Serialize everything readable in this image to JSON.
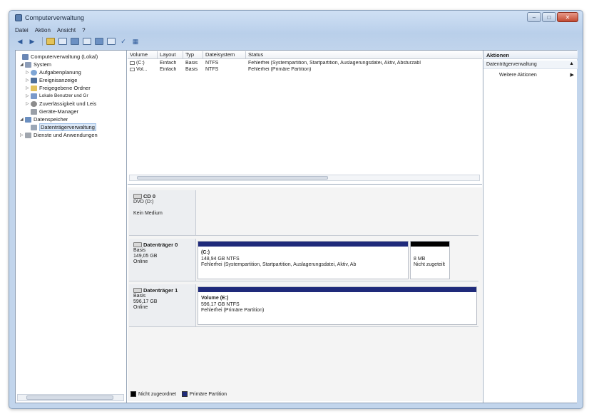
{
  "window": {
    "title": "Computerverwaltung"
  },
  "menu": [
    {
      "label": "Datei"
    },
    {
      "label": "Aktion"
    },
    {
      "label": "Ansicht"
    },
    {
      "label": "?"
    }
  ],
  "tree": {
    "items": [
      {
        "label": "Computerverwaltung (Lokal)",
        "indent": 0,
        "color": "#6a87b5",
        "exp": ""
      },
      {
        "label": "System",
        "indent": 1,
        "color": "#8d9db8",
        "exp": "◢"
      },
      {
        "label": "Aufgabenplanung",
        "indent": 2,
        "color": "#7ea6d6",
        "exp": "▷"
      },
      {
        "label": "Ereignisanzeige",
        "indent": 2,
        "color": "#4d6f9b",
        "exp": "▷"
      },
      {
        "label": "Freigegebene Ordner",
        "indent": 2,
        "color": "#e2c25c",
        "exp": "▷"
      },
      {
        "label": "Lokale Benutzer und Gr",
        "indent": 2,
        "color": "#7a9acb",
        "exp": "▷"
      },
      {
        "label": "Zuverlässigkeit und Leis",
        "indent": 2,
        "color": "#8c8c8c",
        "exp": "▷"
      },
      {
        "label": "Geräte-Manager",
        "indent": 2,
        "color": "#9aa0a8",
        "exp": ""
      },
      {
        "label": "Datenspeicher",
        "indent": 1,
        "color": "#6b8fc0",
        "exp": "◢"
      },
      {
        "label": "Datenträgerverwaltung",
        "indent": 2,
        "color": "#9aa6b6",
        "exp": "",
        "selected": true
      },
      {
        "label": "Dienste und Anwendungen",
        "indent": 1,
        "color": "#a0a6ae",
        "exp": "▷"
      }
    ]
  },
  "volumes": {
    "columns": [
      "Volume",
      "Layout",
      "Typ",
      "Dateisystem",
      "Status"
    ],
    "rows": [
      [
        "(C:)",
        "Einfach",
        "Basis",
        "NTFS",
        "Fehlerfrei (Systempartition, Startpartition, Auslagerungsdatei, Aktiv, Absturzabl"
      ],
      [
        "Vol...",
        "Einfach",
        "Basis",
        "NTFS",
        "Fehlerfrei (Primäre Partition)"
      ]
    ]
  },
  "disks": [
    {
      "name": "CD 0",
      "lines": [
        "DVD (D:)",
        "",
        "Kein Medium"
      ],
      "partitions": []
    },
    {
      "name": "Datenträger 0",
      "lines": [
        "Basis",
        "149,05 GB",
        "Online"
      ],
      "partitions": [
        {
          "name": "(C:)",
          "size": "148,94 GB NTFS",
          "status": "Fehlerfrei (Systempartition, Startpartition, Auslagerungsdatei, Aktiv, Ab",
          "color": "#1f2a7a"
        },
        {
          "name": "",
          "size": "8 MB",
          "status": "Nicht zugeteilt",
          "color": "#000000"
        }
      ]
    },
    {
      "name": "Datenträger 1",
      "lines": [
        "Basis",
        "596,17 GB",
        "Online"
      ],
      "partitions": [
        {
          "name": "Volume (E:)",
          "size": "596,17 GB NTFS",
          "status": "Fehlerfrei (Primäre Partition)",
          "color": "#1f2a7a"
        }
      ]
    }
  ],
  "legend": [
    {
      "label": "Nicht zugeordnet",
      "color": "#000000"
    },
    {
      "label": "Primäre Partition",
      "color": "#1f2a7a"
    }
  ],
  "actions": {
    "title": "Aktionen",
    "section": "Datenträgerverwaltung",
    "items": [
      "Weitere Aktionen"
    ]
  },
  "colors": {
    "primary_partition": "#1f2a7a",
    "unallocated": "#000000"
  }
}
